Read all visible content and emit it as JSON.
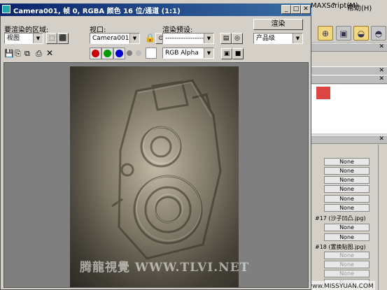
{
  "title": "Camera001, 帧 0, RGBA 颜色 16 位/通道 (1:1)",
  "row1": {
    "area_label": "要渲染的区域:",
    "area_value": "视图",
    "viewport_label": "视口:",
    "viewport_value": "Camera001",
    "preset_label": "渲染预设:",
    "preset_value": "--------------------------",
    "render_button": "渲染",
    "quality_value": "产品级"
  },
  "toolbar2": {
    "channel_value": "RGB Alpha",
    "colors": {
      "red": "#cc0000",
      "green": "#009900",
      "blue": "#0000cc",
      "gray": "#808080"
    }
  },
  "watermark": "腾龍視覺 WWW.TLVI.NET",
  "bg": {
    "menu": [
      "MAXScript(M)",
      "帮助(H)"
    ],
    "none_buttons": [
      "None",
      "None",
      "None",
      "None",
      "None",
      "None",
      "None",
      "None"
    ],
    "map_labels": [
      "#17 (沙子凹凸.jpg)",
      "#18 (置换贴图.jpg)"
    ],
    "disabled_none": [
      "None",
      "None",
      "None",
      "None"
    ],
    "footer": "思缘设计论坛 www.MISSYUAN.COM"
  }
}
